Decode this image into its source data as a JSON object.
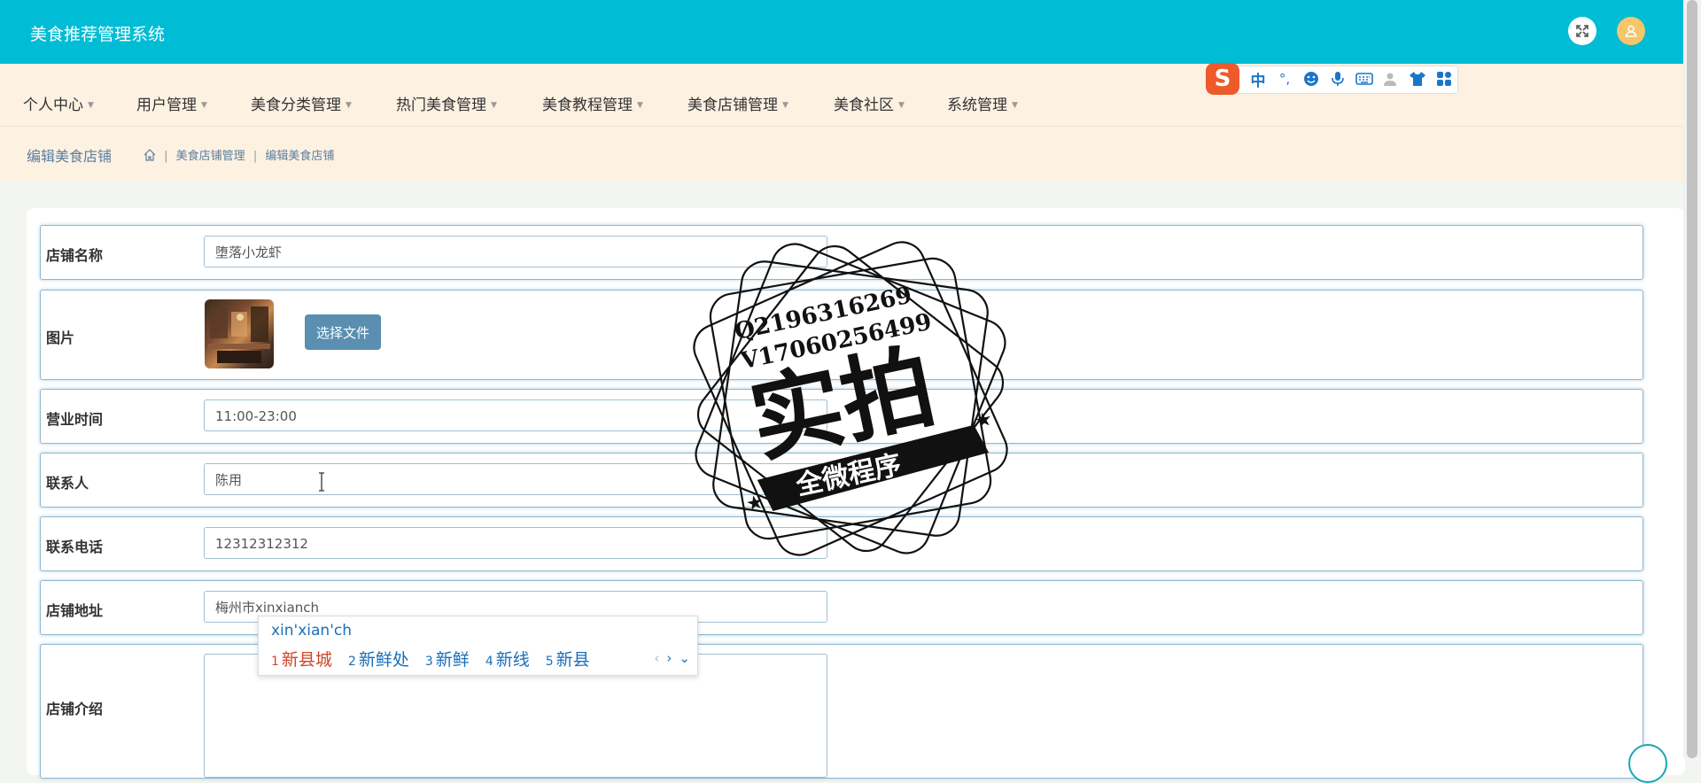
{
  "header": {
    "app_title": "美食推荐管理系统"
  },
  "nav": {
    "items": [
      {
        "label": "个人中心"
      },
      {
        "label": "用户管理"
      },
      {
        "label": "美食分类管理"
      },
      {
        "label": "热门美食管理"
      },
      {
        "label": "美食教程管理"
      },
      {
        "label": "美食店铺管理"
      },
      {
        "label": "美食社区"
      },
      {
        "label": "系统管理"
      }
    ]
  },
  "ime_toolbar": {
    "logo": "S",
    "mode": "中",
    "punct": "°,"
  },
  "breadcrumb": {
    "page_title": "编辑美食店铺",
    "level1": "美食店铺管理",
    "level2": "编辑美食店铺",
    "separator": "|"
  },
  "form": {
    "name": {
      "label": "店铺名称",
      "value": "堕落小龙虾"
    },
    "image": {
      "label": "图片",
      "button": "选择文件"
    },
    "hours": {
      "label": "营业时间",
      "value": "11:00-23:00"
    },
    "contact": {
      "label": "联系人",
      "value": "陈用"
    },
    "phone": {
      "label": "联系电话",
      "value": "12312312312"
    },
    "address": {
      "label": "店铺地址",
      "value": "梅州市xinxianch"
    },
    "intro": {
      "label": "店铺介绍",
      "value": ""
    }
  },
  "ime_popup": {
    "composition": "xin'xian'ch",
    "candidates": [
      {
        "num": "1",
        "text": "新县城"
      },
      {
        "num": "2",
        "text": "新鲜处"
      },
      {
        "num": "3",
        "text": "新鲜"
      },
      {
        "num": "4",
        "text": "新线"
      },
      {
        "num": "5",
        "text": "新县"
      }
    ]
  },
  "watermark": {
    "line1": "Q2196316269",
    "line2": "V17060256499",
    "main": "实拍",
    "banner": "全微程序"
  },
  "colors": {
    "header": "#00bcd4",
    "nav_bg": "#fdf1e2",
    "button": "#5a8fb2",
    "ime_active": "#d0462a",
    "ime_text": "#1b6fb8"
  }
}
